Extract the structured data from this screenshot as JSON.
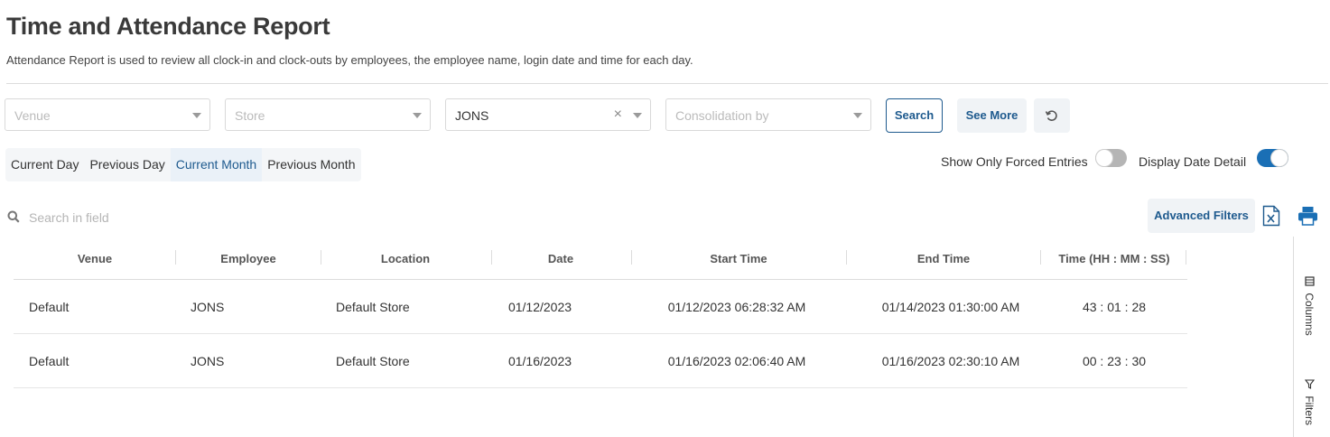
{
  "header": {
    "title": "Time and Attendance Report",
    "subtitle": "Attendance Report is used to review all clock-in and clock-outs by employees, the employee name, login date and time for each day."
  },
  "filters": {
    "venue_placeholder": "Venue",
    "store_placeholder": "Store",
    "employee_value": "JONS",
    "consolidation_placeholder": "Consolidation by",
    "search_label": "Search",
    "see_more_label": "See More"
  },
  "date_range": {
    "options": [
      "Current Day",
      "Previous Day",
      "Current Month",
      "Previous Month"
    ],
    "selected": "Current Month"
  },
  "toggles": {
    "forced_entries_label": "Show Only Forced Entries",
    "forced_entries_on": false,
    "date_detail_label": "Display Date Detail",
    "date_detail_on": true
  },
  "toolbar": {
    "search_placeholder": "Search in field",
    "advanced_filters_label": "Advanced Filters"
  },
  "table": {
    "columns": [
      "Venue",
      "Employee",
      "Location",
      "Date",
      "Start Time",
      "End Time",
      "Time (HH : MM : SS)"
    ],
    "rows": [
      [
        "Default",
        "JONS",
        "Default Store",
        "01/12/2023",
        "01/12/2023 06:28:32 AM",
        "01/14/2023 01:30:00 AM",
        "43 : 01 : 28"
      ],
      [
        "Default",
        "JONS",
        "Default Store",
        "01/16/2023",
        "01/16/2023 02:06:40 AM",
        "01/16/2023 02:30:10 AM",
        "00 : 23 : 30"
      ]
    ]
  },
  "side_panel": {
    "columns_label": "Columns",
    "filters_label": "Filters"
  },
  "colors": {
    "accent": "#1e5a8e",
    "toggle_on": "#1a6fb5",
    "toggle_off": "#b5b5b5"
  },
  "icons": {
    "reset": "rotate-ccw-icon",
    "search": "search-icon",
    "excel": "excel-icon",
    "print": "print-icon",
    "columns": "columns-icon",
    "filters": "filter-icon"
  }
}
